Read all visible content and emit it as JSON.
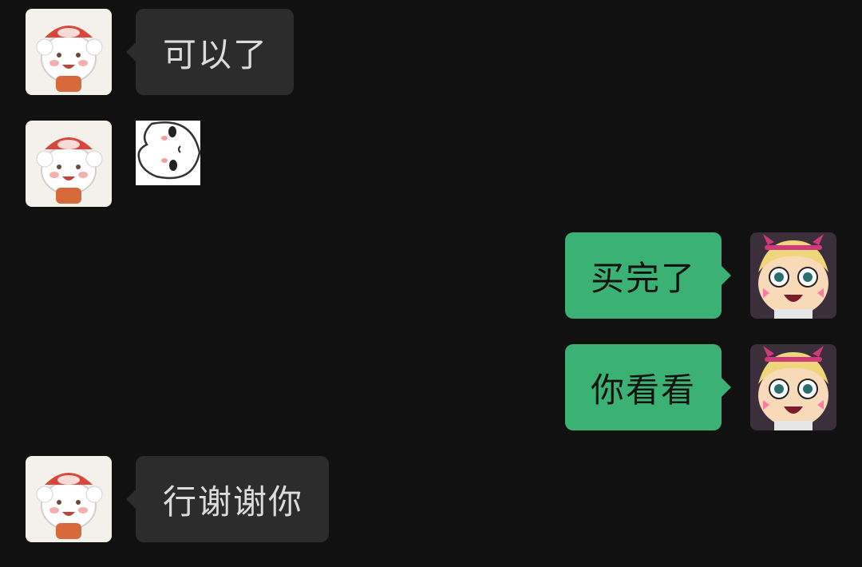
{
  "messages": [
    {
      "sender": "contact",
      "type": "text",
      "text": "可以了"
    },
    {
      "sender": "contact",
      "type": "sticker",
      "sticker_icon": "peeking-face-sticker"
    },
    {
      "sender": "me",
      "type": "text",
      "text": "买完了"
    },
    {
      "sender": "me",
      "type": "text",
      "text": "你看看"
    },
    {
      "sender": "contact",
      "type": "text",
      "text": "行谢谢你"
    }
  ],
  "avatars": {
    "contact": {
      "icon": "sheep-girl-avatar-icon"
    },
    "me": {
      "icon": "star-butterfly-avatar-icon"
    }
  },
  "colors": {
    "background": "#111111",
    "incoming_bubble": "#2c2c2c",
    "incoming_text": "#dcdcdc",
    "outgoing_bubble": "#3bb273",
    "outgoing_text": "#111111"
  }
}
